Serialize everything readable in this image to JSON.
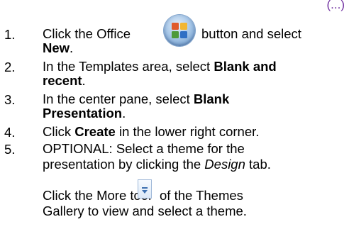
{
  "fragment_top_right": "(...)",
  "steps": [
    {
      "number": "1.",
      "line1_pre": "Click the Office",
      "line1_post": "button and select",
      "line2_bold": "New",
      "line2_post": "."
    },
    {
      "number": "2.",
      "line1_pre": "In the Templates area, select ",
      "line1_bold": "Blank and",
      "line2_bold": "recent",
      "line2_post": "."
    },
    {
      "number": "3.",
      "line1_pre": "In the center pane, select ",
      "line1_bold": "Blank",
      "line2_bold": "Presentation",
      "line2_post": "."
    },
    {
      "number": "4.",
      "line1_pre": "Click ",
      "line1_bold": "Create",
      "line1_post": " in the lower right corner."
    },
    {
      "number": "5.",
      "line1": "OPTIONAL: Select a theme for the",
      "line2_pre": "presentation by clicking the ",
      "line2_ital": "Design",
      "line2_post": " tab."
    }
  ],
  "followup": {
    "line1_pre": "Click the More tool",
    "line1_post": "of the Themes",
    "line2": "Gallery to view and select a theme."
  },
  "icons": {
    "office_button": "office-button-icon",
    "more_tool": "more-tool-icon"
  }
}
